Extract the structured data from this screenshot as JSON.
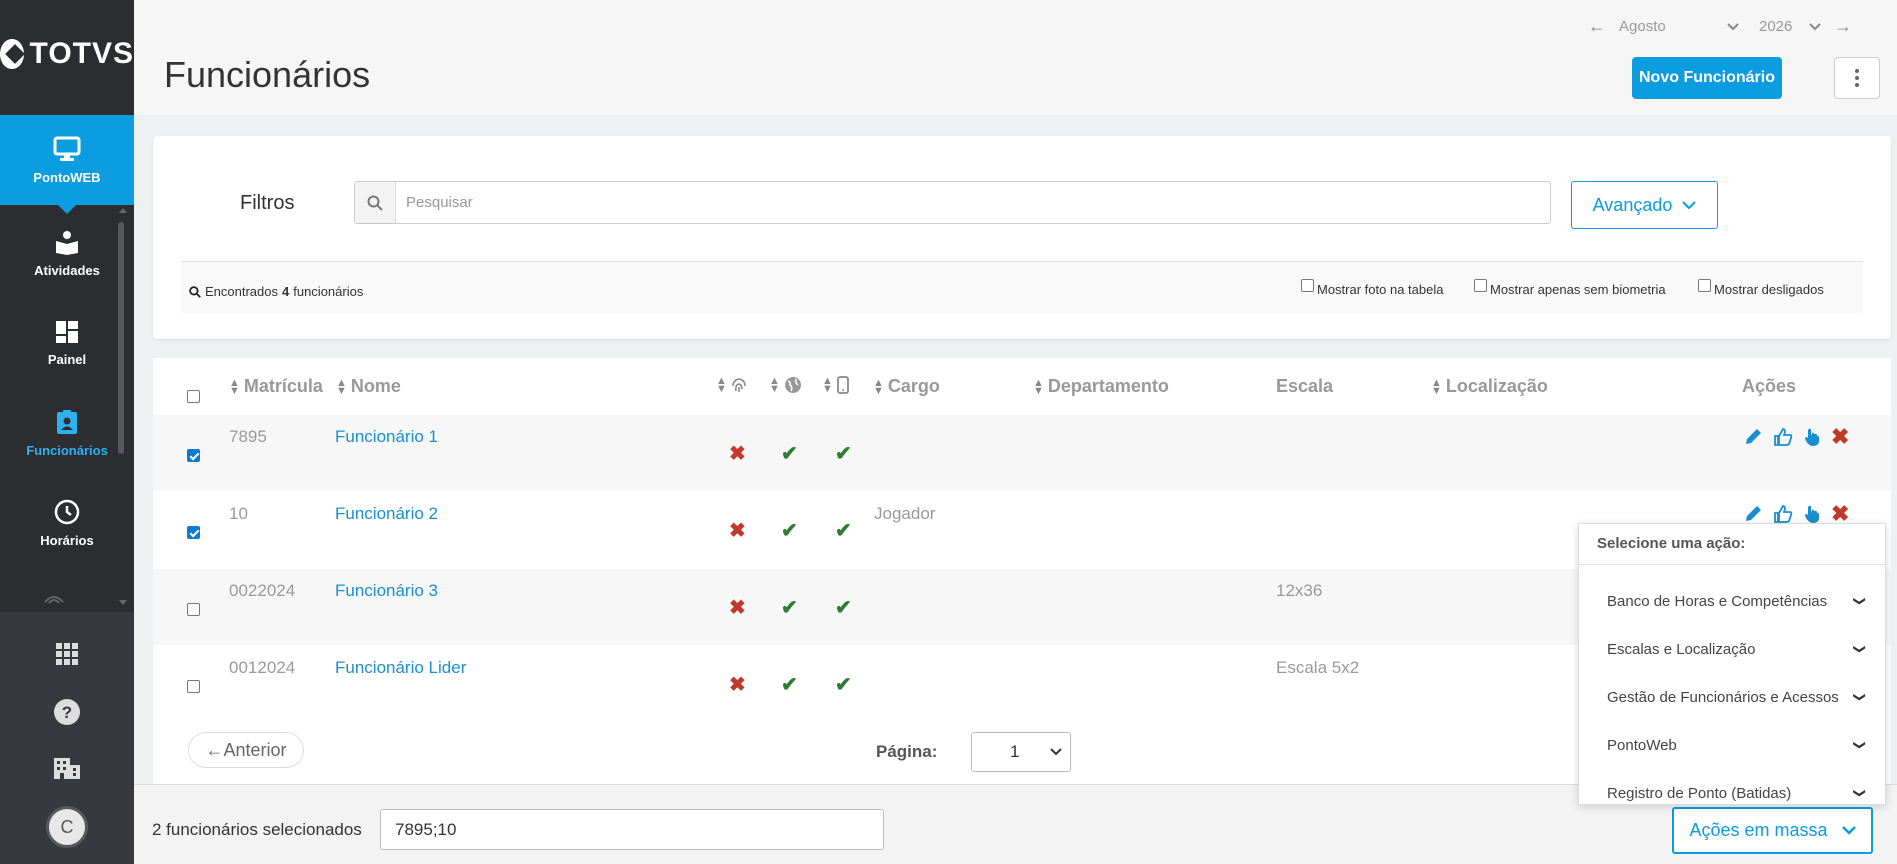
{
  "app": {
    "logo_text": "TOTVS"
  },
  "sidebar": {
    "items": [
      {
        "label": "PontoWEB",
        "icon": "monitor-icon"
      },
      {
        "label": "Atividades",
        "icon": "book-icon"
      },
      {
        "label": "Painel",
        "icon": "dashboard-icon"
      },
      {
        "label": "Funcionários",
        "icon": "badge-icon"
      },
      {
        "label": "Horários",
        "icon": "clock-icon"
      }
    ],
    "bottom_icons": [
      "apps-grid-icon",
      "help-icon",
      "building-icon"
    ],
    "avatar_initial": "C"
  },
  "header": {
    "title": "Funcionários",
    "month": "Agosto",
    "year": "2026",
    "new_button": "Novo Funcionário"
  },
  "filters": {
    "label": "Filtros",
    "search_placeholder": "Pesquisar",
    "advanced_button": "Avançado",
    "found_prefix": "Encontrados",
    "found_count": "4",
    "found_suffix": "funcionários",
    "options": [
      {
        "label": "Mostrar foto na tabela",
        "checked": false
      },
      {
        "label": "Mostrar apenas sem biometria",
        "checked": false
      },
      {
        "label": "Mostrar desligados",
        "checked": false
      }
    ]
  },
  "table": {
    "columns": {
      "matricula": "Matrícula",
      "nome": "Nome",
      "cargo": "Cargo",
      "departamento": "Departamento",
      "escala": "Escala",
      "localizacao": "Localização",
      "acoes": "Ações"
    },
    "rows": [
      {
        "checked": true,
        "matricula": "7895",
        "nome": "Funcionário 1",
        "cargo": "",
        "escala": "",
        "biometria": "x",
        "web": "ok",
        "mobile": "ok"
      },
      {
        "checked": true,
        "matricula": "10",
        "nome": "Funcionário 2",
        "cargo": "Jogador",
        "escala": "",
        "biometria": "x",
        "web": "ok",
        "mobile": "ok"
      },
      {
        "checked": false,
        "matricula": "0022024",
        "nome": "Funcionário 3",
        "cargo": "",
        "escala": "12x36",
        "biometria": "x",
        "web": "ok",
        "mobile": "ok"
      },
      {
        "checked": false,
        "matricula": "0012024",
        "nome": "Funcionário Lider",
        "cargo": "",
        "escala": "Escala 5x2",
        "biometria": "x",
        "web": "ok",
        "mobile": "ok"
      }
    ]
  },
  "pagination": {
    "prev_label": "←Anterior",
    "page_label": "Página:",
    "current_page": "1"
  },
  "footer": {
    "selected_text": "2 funcionários selecionados",
    "selected_ids": "7895;10",
    "mass_actions_button": "Ações em massa"
  },
  "menu": {
    "title": "Selecione uma ação:",
    "items": [
      "Banco de Horas e Competências",
      "Escalas e Localização",
      "Gestão de Funcionários e Acessos",
      "PontoWeb",
      "Registro de Ponto (Batidas)"
    ]
  },
  "colors": {
    "accent": "#0c9ce0",
    "sidebar": "#2b2d31",
    "error": "#c0392b",
    "success": "#2e7d32"
  }
}
